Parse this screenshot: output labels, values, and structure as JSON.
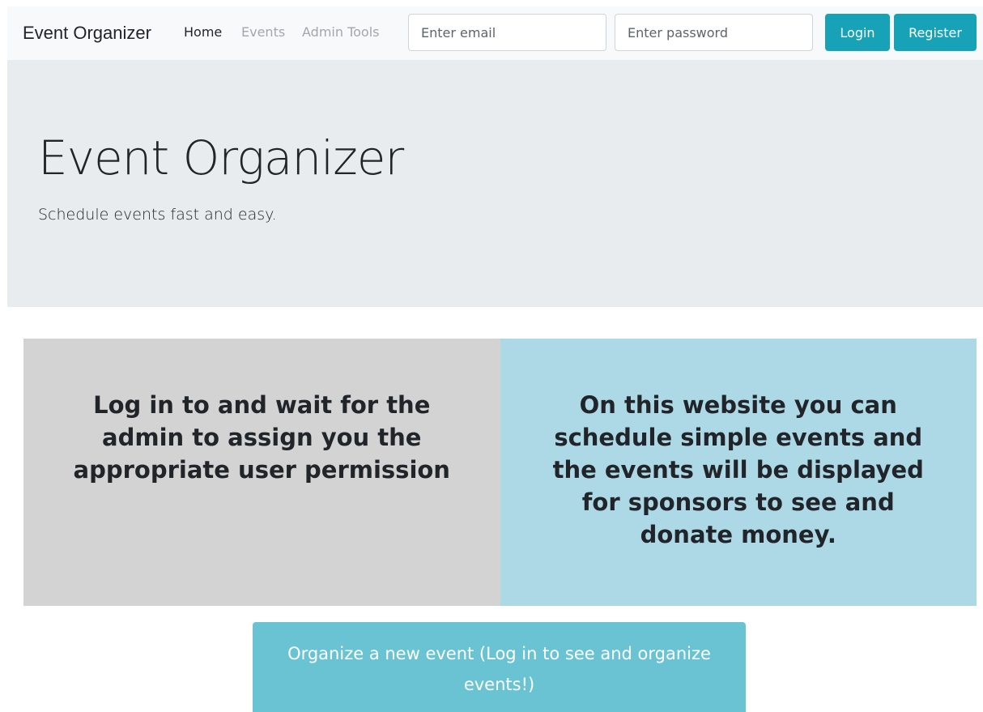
{
  "navbar": {
    "brand": "Event Organizer",
    "links": [
      {
        "label": "Home"
      },
      {
        "label": "Events"
      },
      {
        "label": "Admin Tools"
      }
    ],
    "email_placeholder": "Enter email",
    "password_placeholder": "Enter password",
    "login_label": "Login",
    "register_label": "Register"
  },
  "hero": {
    "title": "Event Organizer",
    "subtitle": "Schedule events fast and easy."
  },
  "panels": {
    "left_text": "Log in to and wait for the admin to assign you the appropriate user permission",
    "right_text": "On this website you can schedule simple events and the events will be displayed for sponsors to see and donate money."
  },
  "cta": {
    "label": "Organize a new event (Log in to see and organize events!)"
  },
  "colors": {
    "navbar_bg": "#f8f9fa",
    "hero_bg": "#e9ecef",
    "button": "#17a2b8",
    "panel_left_bg": "#d3d3d3",
    "panel_right_bg": "#add8e6",
    "cta_bg": "#6ac3d2"
  }
}
